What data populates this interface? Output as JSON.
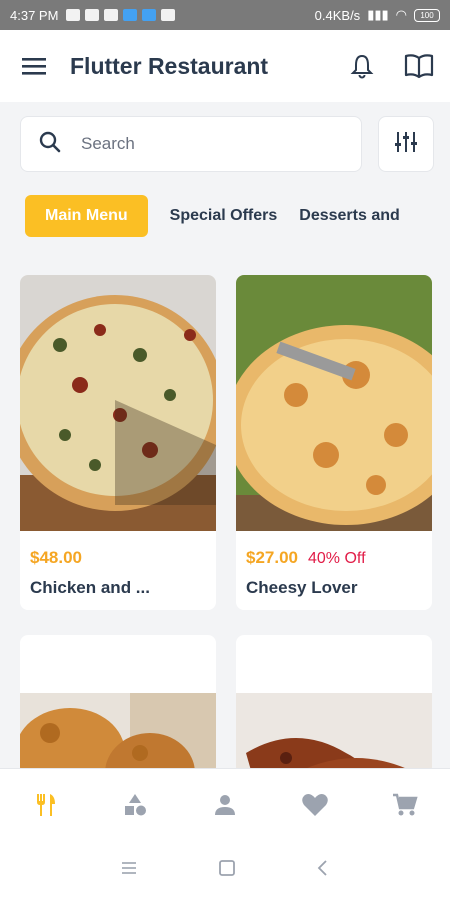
{
  "status_bar": {
    "time": "4:37 PM",
    "net_speed": "0.4KB/s",
    "battery": "100"
  },
  "app_bar": {
    "title": "Flutter Restaurant"
  },
  "search": {
    "placeholder": "Search"
  },
  "tabs": [
    {
      "label": "Main Menu",
      "active": true
    },
    {
      "label": "Special Offers",
      "active": false
    },
    {
      "label": "Desserts and"
    }
  ],
  "products": [
    {
      "price": "$48.00",
      "discount": "",
      "name": "Chicken and ..."
    },
    {
      "price": "$27.00",
      "discount": "40% Off",
      "name": "Cheesy Lover"
    }
  ],
  "colors": {
    "accent": "#fbbf24",
    "price": "#f5a623",
    "discount": "#e11d48",
    "title": "#2b3a4e"
  },
  "nav_icons": [
    "restaurant-icon",
    "category-shapes-icon",
    "person-icon",
    "heart-icon",
    "cart-icon"
  ]
}
